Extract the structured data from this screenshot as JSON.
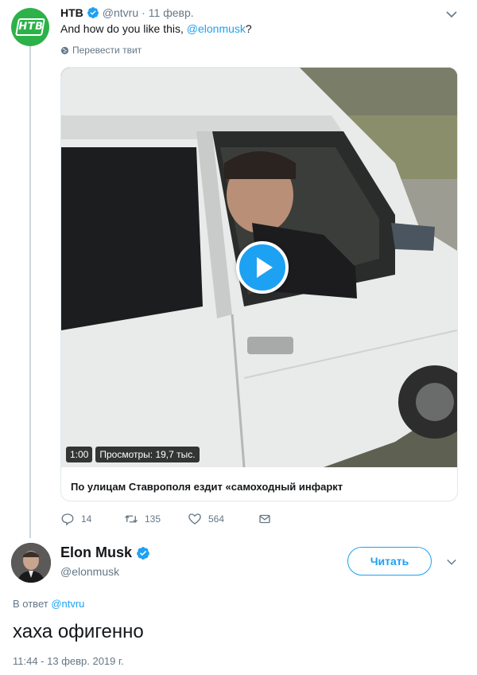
{
  "original_tweet": {
    "author_name": "НТВ",
    "handle": "@ntvru",
    "separator": "·",
    "date": "11 февр.",
    "text_prefix": "And how do you like this, ",
    "text_mention": "@elonmusk",
    "text_suffix": "?",
    "translate_label": "Перевести твит",
    "avatar_logo_text": "НТВ",
    "media": {
      "duration": "1:00",
      "views": "Просмотры: 19,7 тыс.",
      "card_title": "По улицам Ставрополя ездит «самоходный инфаркт"
    },
    "actions": {
      "replies": "14",
      "retweets": "135",
      "likes": "564"
    }
  },
  "reply_tweet": {
    "author_name": "Elon Musk",
    "handle": "@elonmusk",
    "follow_label": "Читать",
    "reply_to_prefix": "В ответ ",
    "reply_to_handle": "@ntvru",
    "text": "хаха офигенно",
    "timestamp": "11:44 - 13 февр. 2019 г."
  },
  "colors": {
    "accent": "#1da1f2",
    "ntv_green": "#2db149",
    "secondary_text": "#657786",
    "border": "#e1e8ed"
  },
  "icons": [
    "verified-badge-icon",
    "chevron-down-icon",
    "globe-icon",
    "play-icon",
    "reply-icon",
    "retweet-icon",
    "like-icon",
    "message-icon"
  ]
}
